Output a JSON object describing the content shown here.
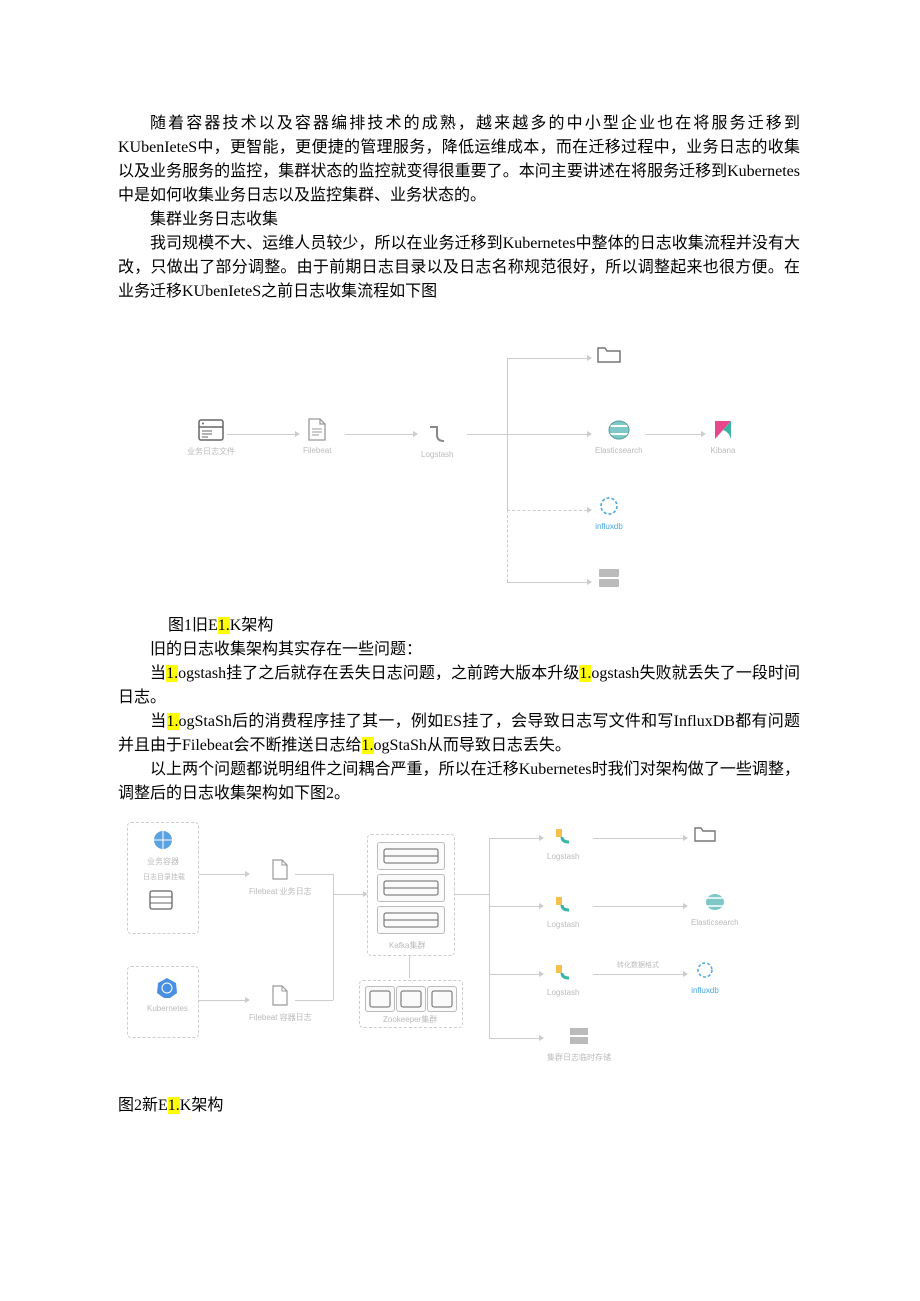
{
  "p1": "随着容器技术以及容器编排技术的成熟，越来越多的中小型企业也在将服务迁移到KUbenIeteS中，更智能，更便捷的管理服务，降低运维成本，而在迁移过程中，业务日志的收集以及业务服务的监控，集群状态的监控就变得很重要了。本问主要讲述在将服务迁移到Kubernetes中是如何收集业务日志以及监控集群、业务状态的。",
  "p2": "集群业务日志收集",
  "p3": "我司规模不大、运维人员较少，所以在业务迁移到Kubernetes中整体的日志收集流程并没有大改，只做出了部分调整。由于前期日志目录以及日志名称规范很好，所以调整起来也很方便。在业务迁移KUbenIeteS之前日志收集流程如下图",
  "fig1_cap_a": "图1旧E",
  "fig1_cap_hl": "1.",
  "fig1_cap_b": "K架构",
  "p4": "旧的日志收集架构其实存在一些问题：",
  "p5a": "当",
  "p5h": "1.",
  "p5b": "ogstash挂了之后就存在丢失日志问题，之前跨大版本升级",
  "p5h2": "1.",
  "p5c": "ogstash失败就丢失了一段时间日志。",
  "p6a": "当",
  "p6h": "1.",
  "p6b": "ogStaSh后的消费程序挂了其一，例如ES挂了，会导致日志写文件和写InfluxDB都有问题并且由于Filebeat会不断推送日志给",
  "p6h2": "1.",
  "p6c": "ogStaSh从而导致日志丢失。",
  "p7": "以上两个问题都说明组件之间耦合严重，所以在迁移Kubernetes时我们对架构做了一些调整，调整后的日志收集架构如下图2。",
  "fig2_cap_a": "图2新E",
  "fig2_cap_hl": "1.",
  "fig2_cap_b": "K架构",
  "d1": {
    "n1": "业务日志文件",
    "n2": "Filebeat",
    "n3": "Logstash",
    "n4_top": "",
    "n5": "Elasticsearch",
    "n6": "Kibana",
    "n7": "influxdb",
    "n8": ""
  },
  "d2": {
    "box1a": "业务容器",
    "box1b": "日志目录挂载",
    "box2": "Filebeat 业务日志",
    "box3": "Kubernetes",
    "box4": "Filebeat 容器日志",
    "kafka": "Kafka集群",
    "zk": "Zookeeper集群",
    "ls": "Logstash",
    "hl": "转化数据格式",
    "es": "Elasticsearch",
    "influx": "influxdb",
    "file": "",
    "tail": "集群日志临时存储"
  }
}
